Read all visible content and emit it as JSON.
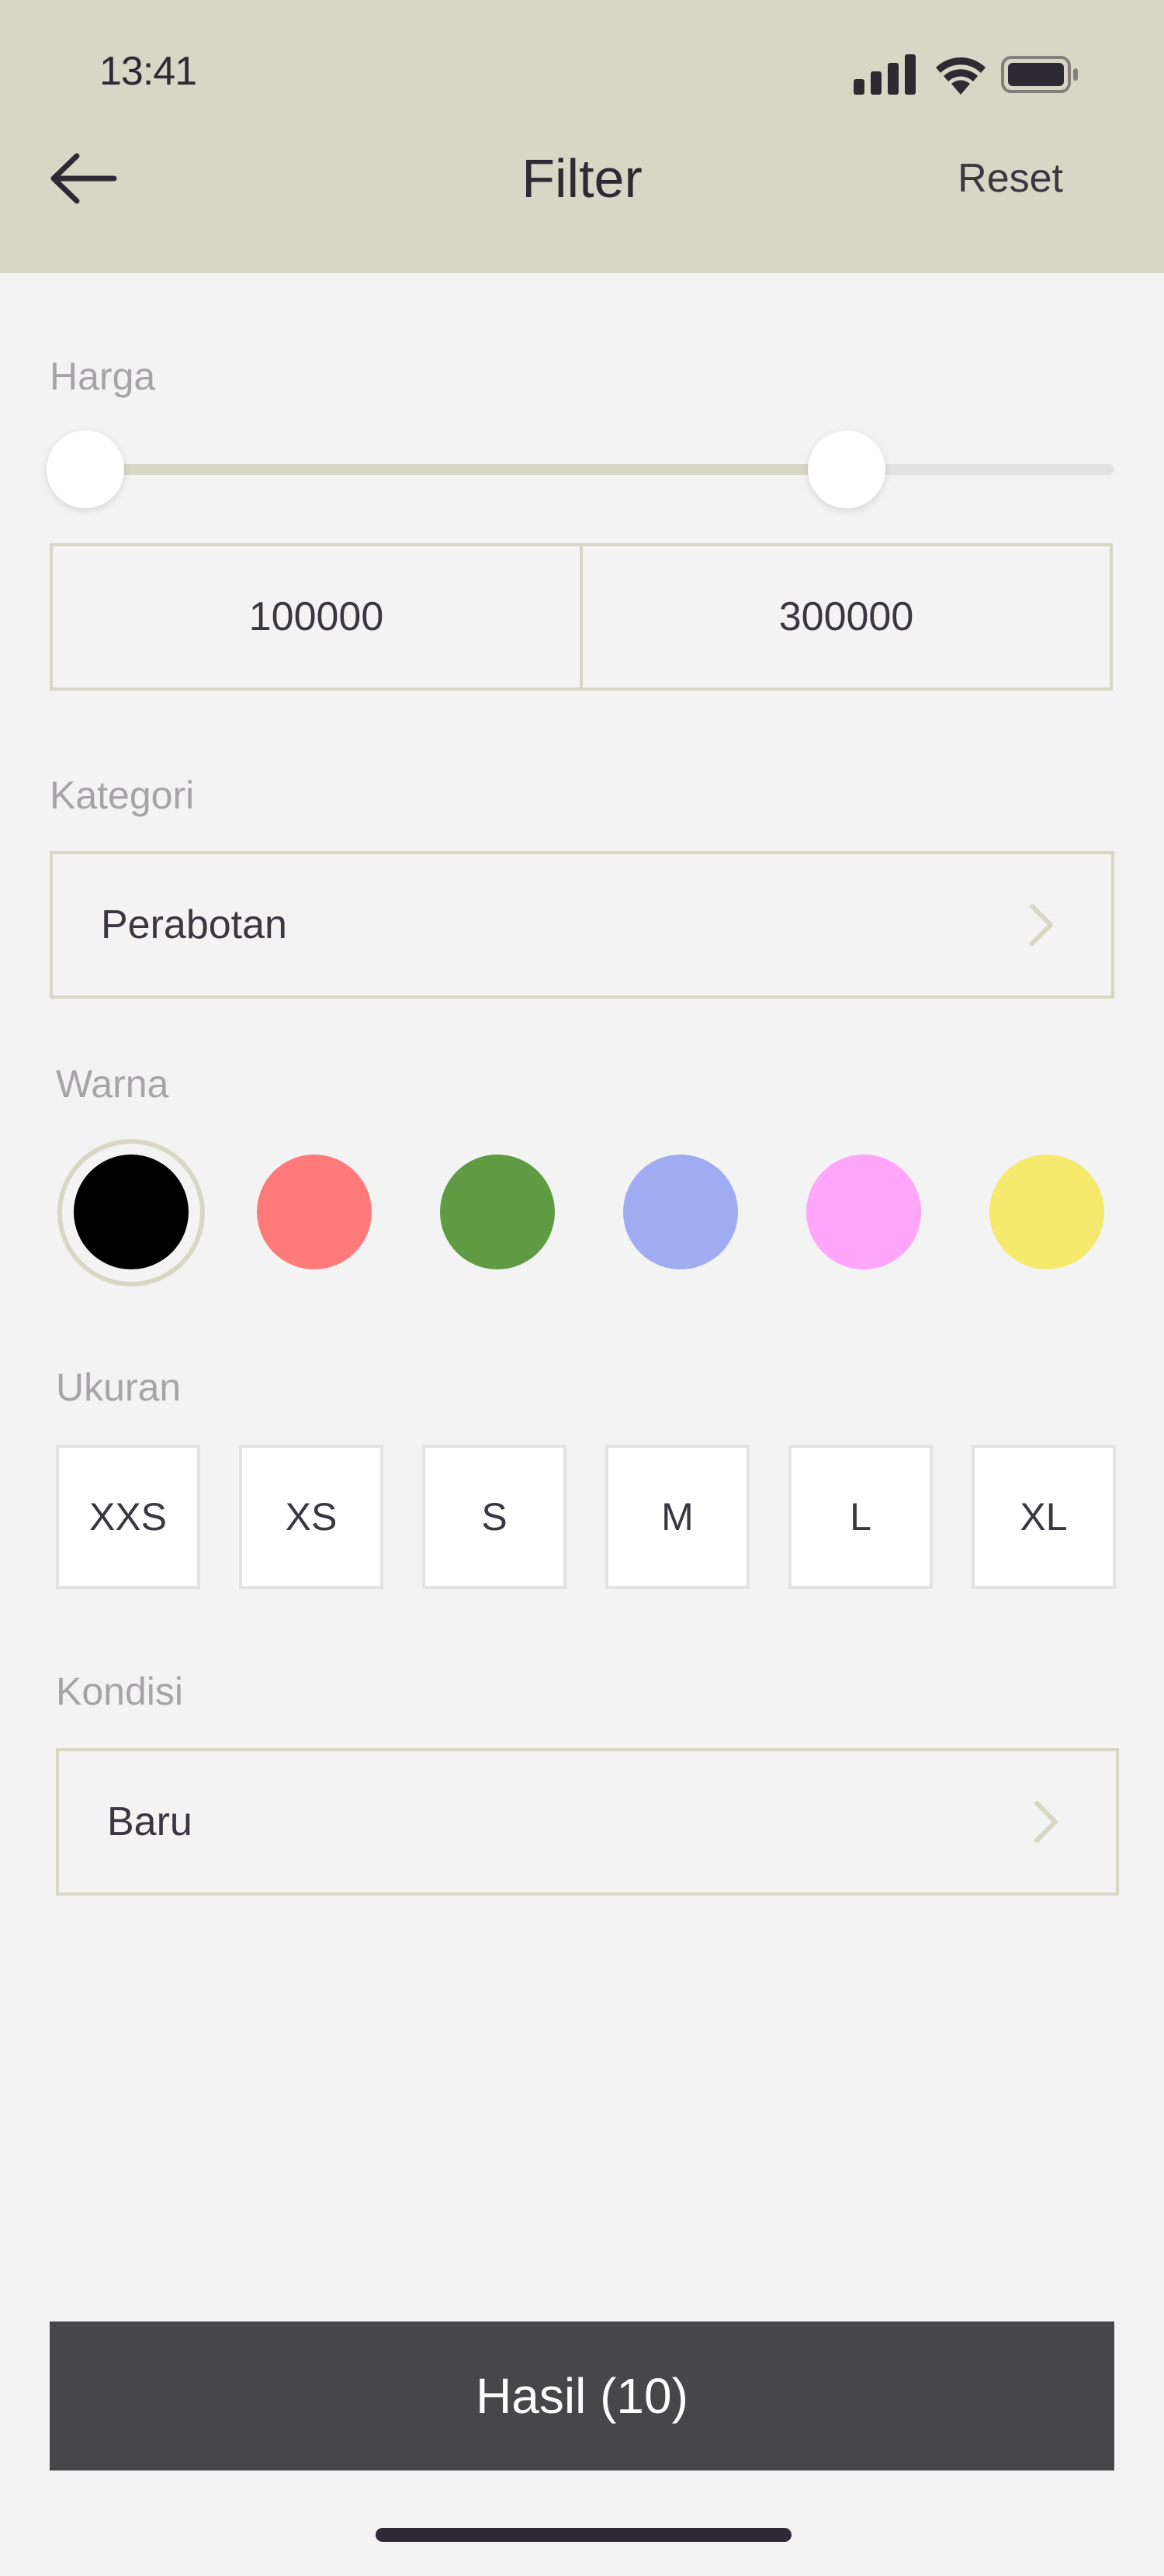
{
  "status_bar": {
    "time": "13:41",
    "icons": [
      "signal-icon",
      "wifi-icon",
      "battery-icon"
    ]
  },
  "header": {
    "title": "Filter",
    "reset_label": "Reset",
    "back_icon": "arrow-left-icon"
  },
  "price": {
    "label": "Harga",
    "min_value": "100000",
    "max_value": "300000",
    "range_low_fraction": 0.0,
    "range_high_fraction": 0.74
  },
  "category": {
    "label": "Kategori",
    "value": "Perabotan"
  },
  "color": {
    "label": "Warna",
    "swatches": [
      {
        "hex": "#000000",
        "selected": true
      },
      {
        "hex": "#ff7b79",
        "selected": false
      },
      {
        "hex": "#5e9b42",
        "selected": false
      },
      {
        "hex": "#a0acf2",
        "selected": false
      },
      {
        "hex": "#ffa6fb",
        "selected": false
      },
      {
        "hex": "#f5e96e",
        "selected": false
      }
    ]
  },
  "size": {
    "label": "Ukuran",
    "options": [
      "XXS",
      "XS",
      "S",
      "M",
      "L",
      "XL"
    ]
  },
  "condition": {
    "label": "Kondisi",
    "value": "Baru"
  },
  "cta": {
    "label": "Hasil (10)"
  },
  "colors": {
    "header_bg": "#d8d6c4",
    "accent": "#d8d6c4",
    "page_bg": "#f3f3f3",
    "button_bg": "#474649",
    "text": "#3b3640",
    "muted_text": "#a7a4a7"
  }
}
